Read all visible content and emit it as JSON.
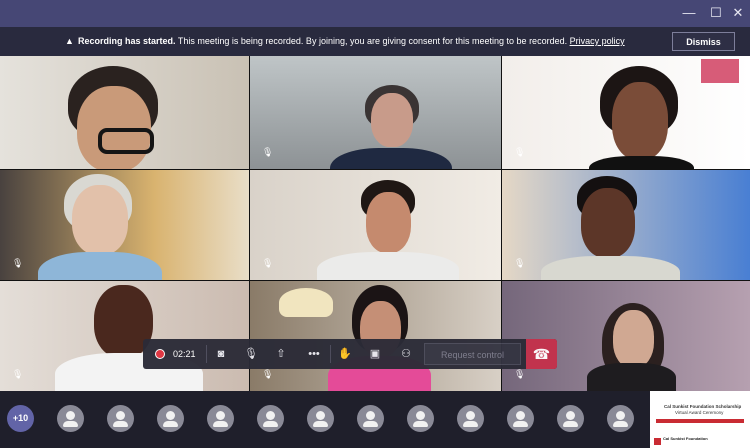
{
  "window": {
    "minimize_icon": "minimize-icon",
    "maximize_icon": "maximize-icon",
    "close_icon": "close-icon",
    "titlebar_color": "#464775"
  },
  "banner": {
    "warning_icon": "▲",
    "title": "Recording has started.",
    "message": " This meeting is being recorded. By joining, you are giving consent for this meeting to be recorded. ",
    "privacy_link": "Privacy policy",
    "dismiss_label": "Dismiss"
  },
  "video_tiles": [
    {
      "name": "participant-1",
      "muted": false
    },
    {
      "name": "participant-2",
      "muted": true
    },
    {
      "name": "participant-3",
      "muted": true
    },
    {
      "name": "participant-4",
      "muted": true
    },
    {
      "name": "participant-5",
      "muted": true
    },
    {
      "name": "participant-6",
      "muted": true
    },
    {
      "name": "participant-7",
      "muted": true
    },
    {
      "name": "participant-8",
      "muted": true
    },
    {
      "name": "participant-9",
      "muted": true
    }
  ],
  "controls": {
    "timer": "02:21",
    "request_control": "Request control",
    "icons": [
      "record-icon",
      "camera-off-icon",
      "mic-off-icon",
      "share-screen-icon",
      "more-actions-icon",
      "raise-hand-icon",
      "chat-icon",
      "participants-icon",
      "hang-up-icon"
    ],
    "hangup_color": "#c4314b"
  },
  "participants_bar": {
    "more_count": "+10",
    "avatars": 12
  },
  "shared_content": {
    "title": "Cal Sunkist Foundation Scholarship",
    "subtitle": "Virtual Award Ceremony",
    "logo_text": "Cal Sunkist Foundation"
  }
}
